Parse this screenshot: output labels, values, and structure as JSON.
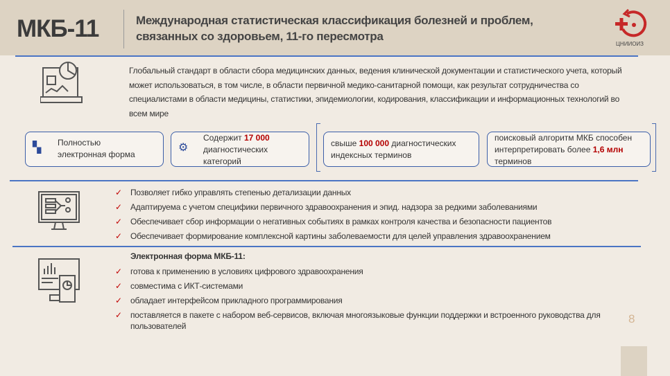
{
  "header": {
    "code": "МКБ-11",
    "title_line1": "Международная статистическая классификация болезней и проблем,",
    "title_line2": "связанных со здоровьем,  11-го пересмотра",
    "logo_text": "ЦНИИОИЗ"
  },
  "intro": "Глобальный стандарт в области сбора медицинских данных, ведения клинической документации и статистического учета, который может использоваться, в том числе, в области первичной медико-санитарной помощи, как результат сотрудничества со специалистами в области медицины, статистики, эпидемиологии, кодирования, классификации и информационных технологий во всем мире",
  "cards": [
    {
      "line1": "Полностью",
      "line2": "электронная форма"
    },
    {
      "prefix": "Содержит ",
      "highlight": "17 000",
      "rest": "диагностических категорий"
    },
    {
      "prefix": "свыше ",
      "highlight": "100 000",
      "rest": " диагностических индексных терминов"
    },
    {
      "prefix": "поисковый алгоритм МКБ способен интерпретировать более ",
      "highlight": "1,6 млн",
      "rest": " терминов"
    }
  ],
  "features": [
    "Позволяет гибко управлять степенью детализации данных",
    "Адаптируема с учетом специфики первичного здравоохранения и эпид. надзора за редкими заболеваниями",
    "Обеспечивает сбор информации о негативных событиях в рамках контроля качества и безопасности пациентов",
    "Обеспечивает формирование комплексной картины заболеваемости для целей управления здравоохранением"
  ],
  "electronic": {
    "heading": "Электронная форма МКБ-11:",
    "items": [
      "готова к применению в условиях цифрового здравоохранения",
      "совместима с ИКТ-системами",
      "обладает интерфейсом прикладного программирования",
      "поставляется в пакете с набором веб-сервисов, включая многоязыковые функции поддержки и встроенного руководства для пользователей"
    ]
  },
  "check_mark": "✓",
  "page_number": "8",
  "colors": {
    "accent_red": "#b40000",
    "line_blue": "#4a74c4",
    "header_bg": "#ddd3c3"
  }
}
